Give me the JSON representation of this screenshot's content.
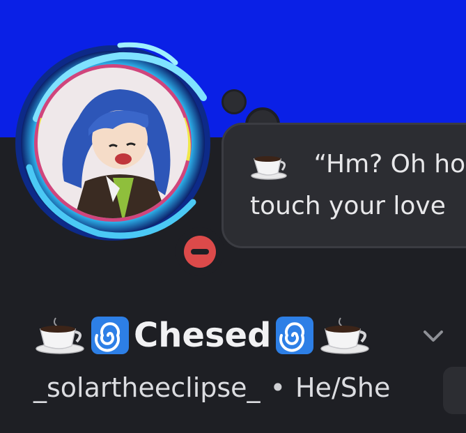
{
  "colors": {
    "banner": "#0a20e6",
    "background": "#1e1f24",
    "status_dnd": "#dc4a4a",
    "bubble": "#2c2d32"
  },
  "profile": {
    "display_name": "Chesed",
    "username": "_solartheeclipse_",
    "pronouns": "He/She",
    "separator": "•",
    "status": "do-not-disturb",
    "name_decorations": [
      "coffee-icon",
      "spiral-icon",
      "spiral-icon",
      "coffee-icon"
    ]
  },
  "custom_status": {
    "emoji": "coffee-icon",
    "line1": "“Hm? Oh ho",
    "line2": "touch your love"
  }
}
